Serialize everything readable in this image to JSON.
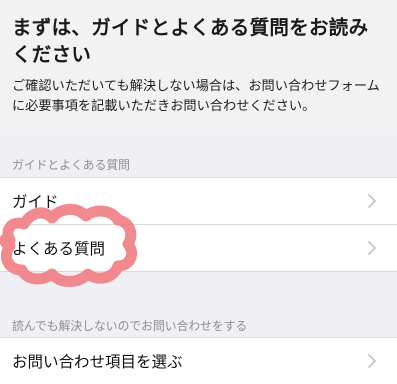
{
  "header": {
    "title": "まずは、ガイドとよくある質問をお読みください",
    "description": "ご確認いただいても解決しない場合は、お問い合わせフォームに必要事項を記載いただきお問い合わせください。"
  },
  "sections": [
    {
      "label": "ガイドとよくある質問",
      "items": [
        {
          "label": "ガイド",
          "icon": "chevron-right-icon"
        },
        {
          "label": "よくある質問",
          "icon": "chevron-right-icon"
        }
      ]
    },
    {
      "label": "読んでも解決しないのでお問い合わせをする",
      "items": [
        {
          "label": "お問い合わせ項目を選ぶ",
          "icon": "chevron-right-icon"
        }
      ]
    }
  ],
  "annotation": {
    "color": "#f07f86"
  }
}
